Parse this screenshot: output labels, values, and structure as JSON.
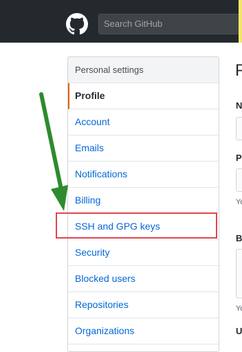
{
  "header": {
    "search_placeholder": "Search GitHub",
    "colors": {
      "bar": "#24292e",
      "accent_edge": "#f6e76a"
    }
  },
  "sidebar": {
    "heading": "Personal settings",
    "items": [
      {
        "label": "Profile",
        "selected": true
      },
      {
        "label": "Account"
      },
      {
        "label": "Emails"
      },
      {
        "label": "Notifications"
      },
      {
        "label": "Billing"
      },
      {
        "label": "SSH and GPG keys",
        "highlighted": true
      },
      {
        "label": "Security"
      },
      {
        "label": "Blocked users"
      },
      {
        "label": "Repositories"
      },
      {
        "label": "Organizations"
      }
    ]
  },
  "main": {
    "title": "P",
    "fields": [
      {
        "label": "N"
      },
      {
        "label": "P",
        "hint": "Yo"
      },
      {
        "label": "B",
        "hint": "Yo"
      },
      {
        "label": "U"
      }
    ]
  },
  "annotation": {
    "arrow_color": "#2e8b2e",
    "box_color": "#e0454b"
  }
}
